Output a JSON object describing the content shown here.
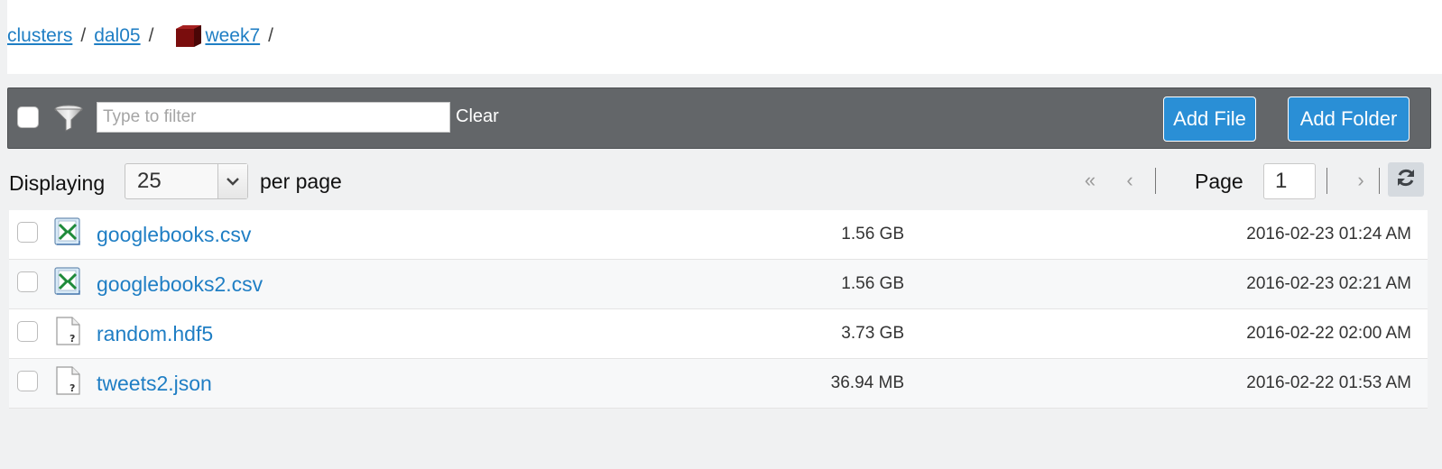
{
  "breadcrumb": {
    "items": [
      {
        "label": "clusters"
      },
      {
        "label": "dal05"
      },
      {
        "label": "week7"
      }
    ],
    "separator": "/",
    "cube_icon": "container-cube-icon",
    "cube_color": "#7a0d0d"
  },
  "toolbar": {
    "filter_placeholder": "Type to filter",
    "filter_value": "",
    "clear_label": "Clear",
    "add_file_label": "Add File",
    "add_folder_label": "Add Folder",
    "filter_icon": "funnel-icon",
    "accent_color": "#2a8fd6"
  },
  "pager": {
    "displaying_label": "Displaying",
    "per_page_value": "25",
    "per_page_label": "per page",
    "page_label": "Page",
    "page_value": "1",
    "first_icon": "«",
    "prev_icon": "‹",
    "next_icon": "›",
    "refresh_icon": "refresh-icon"
  },
  "files": [
    {
      "name": "googlebooks.csv",
      "size": "1.56 GB",
      "date": "2016-02-23 01:24 AM",
      "icon": "spreadsheet-file-icon"
    },
    {
      "name": "googlebooks2.csv",
      "size": "1.56 GB",
      "date": "2016-02-23 02:21 AM",
      "icon": "spreadsheet-file-icon"
    },
    {
      "name": "random.hdf5",
      "size": "3.73 GB",
      "date": "2016-02-22 02:00 AM",
      "icon": "unknown-file-icon"
    },
    {
      "name": "tweets2.json",
      "size": "36.94 MB",
      "date": "2016-02-22 01:53 AM",
      "icon": "unknown-file-icon"
    }
  ]
}
